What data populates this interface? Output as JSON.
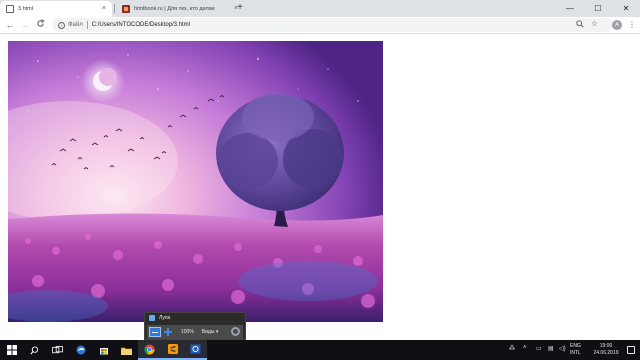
{
  "tabs": [
    {
      "label": "3.html",
      "close": "×",
      "active": true
    },
    {
      "label": "htmlbook.ru | Для тех, кто делае",
      "close": "×",
      "active": false
    }
  ],
  "new_tab_label": "+",
  "window_controls": {
    "minimize": "—",
    "maximize": "☐",
    "close": "✕"
  },
  "toolbar": {
    "back": "←",
    "forward": "→",
    "reload": "C",
    "site_label": "Файл",
    "url": "C:/Users/INTOCODE/Desktop/3.html",
    "zoom_icon": "search-icon",
    "star_icon": "star-icon",
    "avatar_letter": "A",
    "menu": "⋮"
  },
  "page_image": {
    "description_icon": "landscape-image",
    "colors": {
      "sky_top": "#5c2a8c",
      "sky_mid": "#c47ad8",
      "glow": "#f4d6ee",
      "tree": "#4a3c8a",
      "field": "#b83ca8"
    }
  },
  "magnifier": {
    "title": "Лупа",
    "zoom_level": "100%",
    "views_label": "Виды",
    "views_arrow": "▾"
  },
  "taskbar": {
    "apps": [
      "windows-start-icon",
      "search-icon",
      "task-view-icon",
      "edge-icon",
      "store-icon",
      "file-explorer-icon",
      "mail-icon",
      "chrome-icon",
      "sublime-icon",
      "magnifier-icon"
    ],
    "language": [
      "ENG",
      "INTL"
    ],
    "time": "19:00",
    "date": "24.06.2019"
  }
}
